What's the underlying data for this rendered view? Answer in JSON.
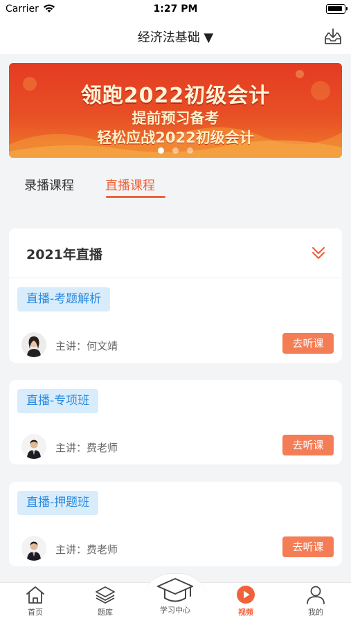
{
  "status_bar": {
    "carrier": "Carrier",
    "time": "1:27 PM"
  },
  "nav": {
    "title": "经济法基础 ▼"
  },
  "banner": {
    "title": "领跑2022初级会计",
    "line1": "提前预习备考",
    "line2": "轻松应战2022初级会计",
    "colors": {
      "top": "#e43b23",
      "bottom": "#f07a2c"
    }
  },
  "tabs": [
    {
      "label": "录播课程",
      "active": false
    },
    {
      "label": "直播课程",
      "active": true
    }
  ],
  "section": {
    "title": "2021年直播"
  },
  "courses": [
    {
      "tag": "直播-考题解析",
      "teacher": "主讲：何文靖",
      "button": "去听课"
    },
    {
      "tag": "直播-专项班",
      "teacher": "主讲：费老师",
      "button": "去听课"
    },
    {
      "tag": "直播-押题班",
      "teacher": "主讲：费老师",
      "button": "去听课"
    }
  ],
  "tab_bar": [
    {
      "label": "首页",
      "icon": "home-icon"
    },
    {
      "label": "题库",
      "icon": "layers-icon"
    },
    {
      "label": "学习中心",
      "icon": "graduation-cap-icon"
    },
    {
      "label": "视频",
      "icon": "play-circle-icon",
      "active": true
    },
    {
      "label": "我的",
      "icon": "user-icon"
    }
  ],
  "colors": {
    "accent": "#f0623a",
    "tag_bg": "#d9ecfb",
    "tag_text": "#2b8be0",
    "button": "#f47d56"
  }
}
